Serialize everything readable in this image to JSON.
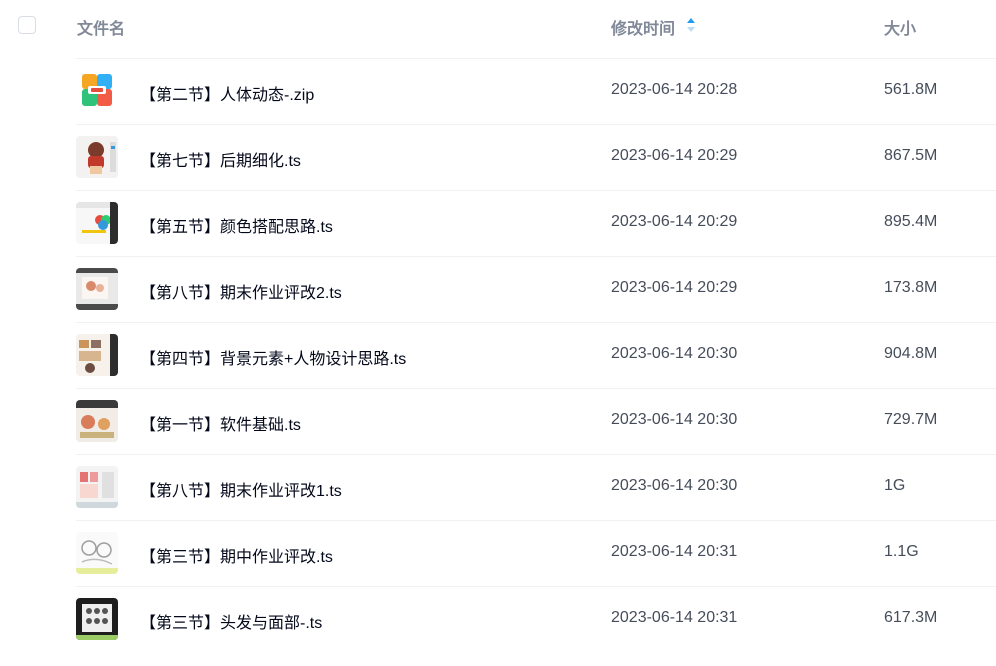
{
  "header": {
    "name_label": "文件名",
    "time_label": "修改时间",
    "size_label": "大小"
  },
  "files": [
    {
      "name": "【第二节】人体动态-.zip",
      "time": "2023-06-14 20:28",
      "size": "561.8M",
      "thumb": "zip-archive-icon"
    },
    {
      "name": "【第七节】后期细化.ts",
      "time": "2023-06-14 20:29",
      "size": "867.5M",
      "thumb": "video-thumbnail"
    },
    {
      "name": "【第五节】颜色搭配思路.ts",
      "time": "2023-06-14 20:29",
      "size": "895.4M",
      "thumb": "video-thumbnail"
    },
    {
      "name": "【第八节】期末作业评改2.ts",
      "time": "2023-06-14 20:29",
      "size": "173.8M",
      "thumb": "video-thumbnail"
    },
    {
      "name": "【第四节】背景元素+人物设计思路.ts",
      "time": "2023-06-14 20:30",
      "size": "904.8M",
      "thumb": "video-thumbnail"
    },
    {
      "name": "【第一节】软件基础.ts",
      "time": "2023-06-14 20:30",
      "size": "729.7M",
      "thumb": "video-thumbnail"
    },
    {
      "name": "【第八节】期末作业评改1.ts",
      "time": "2023-06-14 20:30",
      "size": "1G",
      "thumb": "video-thumbnail"
    },
    {
      "name": "【第三节】期中作业评改.ts",
      "time": "2023-06-14 20:31",
      "size": "1.1G",
      "thumb": "video-thumbnail"
    },
    {
      "name": "【第三节】头发与面部-.ts",
      "time": "2023-06-14 20:31",
      "size": "617.3M",
      "thumb": "video-thumbnail"
    }
  ]
}
